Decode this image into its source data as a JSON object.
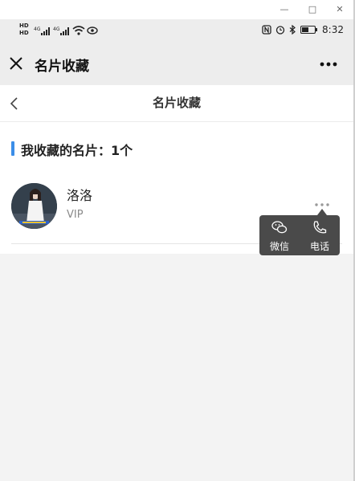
{
  "status_bar": {
    "left_badges": [
      "HD",
      "HD"
    ],
    "network": [
      "4G",
      "4G"
    ],
    "time": "8:32"
  },
  "titlebar": {
    "title": "名片收藏"
  },
  "page_header": {
    "title": "名片收藏"
  },
  "section": {
    "title": "我收藏的名片：1个"
  },
  "card": {
    "name": "洛洛",
    "level": "VIP"
  },
  "popup": {
    "wechat_label": "微信",
    "phone_label": "电话"
  }
}
